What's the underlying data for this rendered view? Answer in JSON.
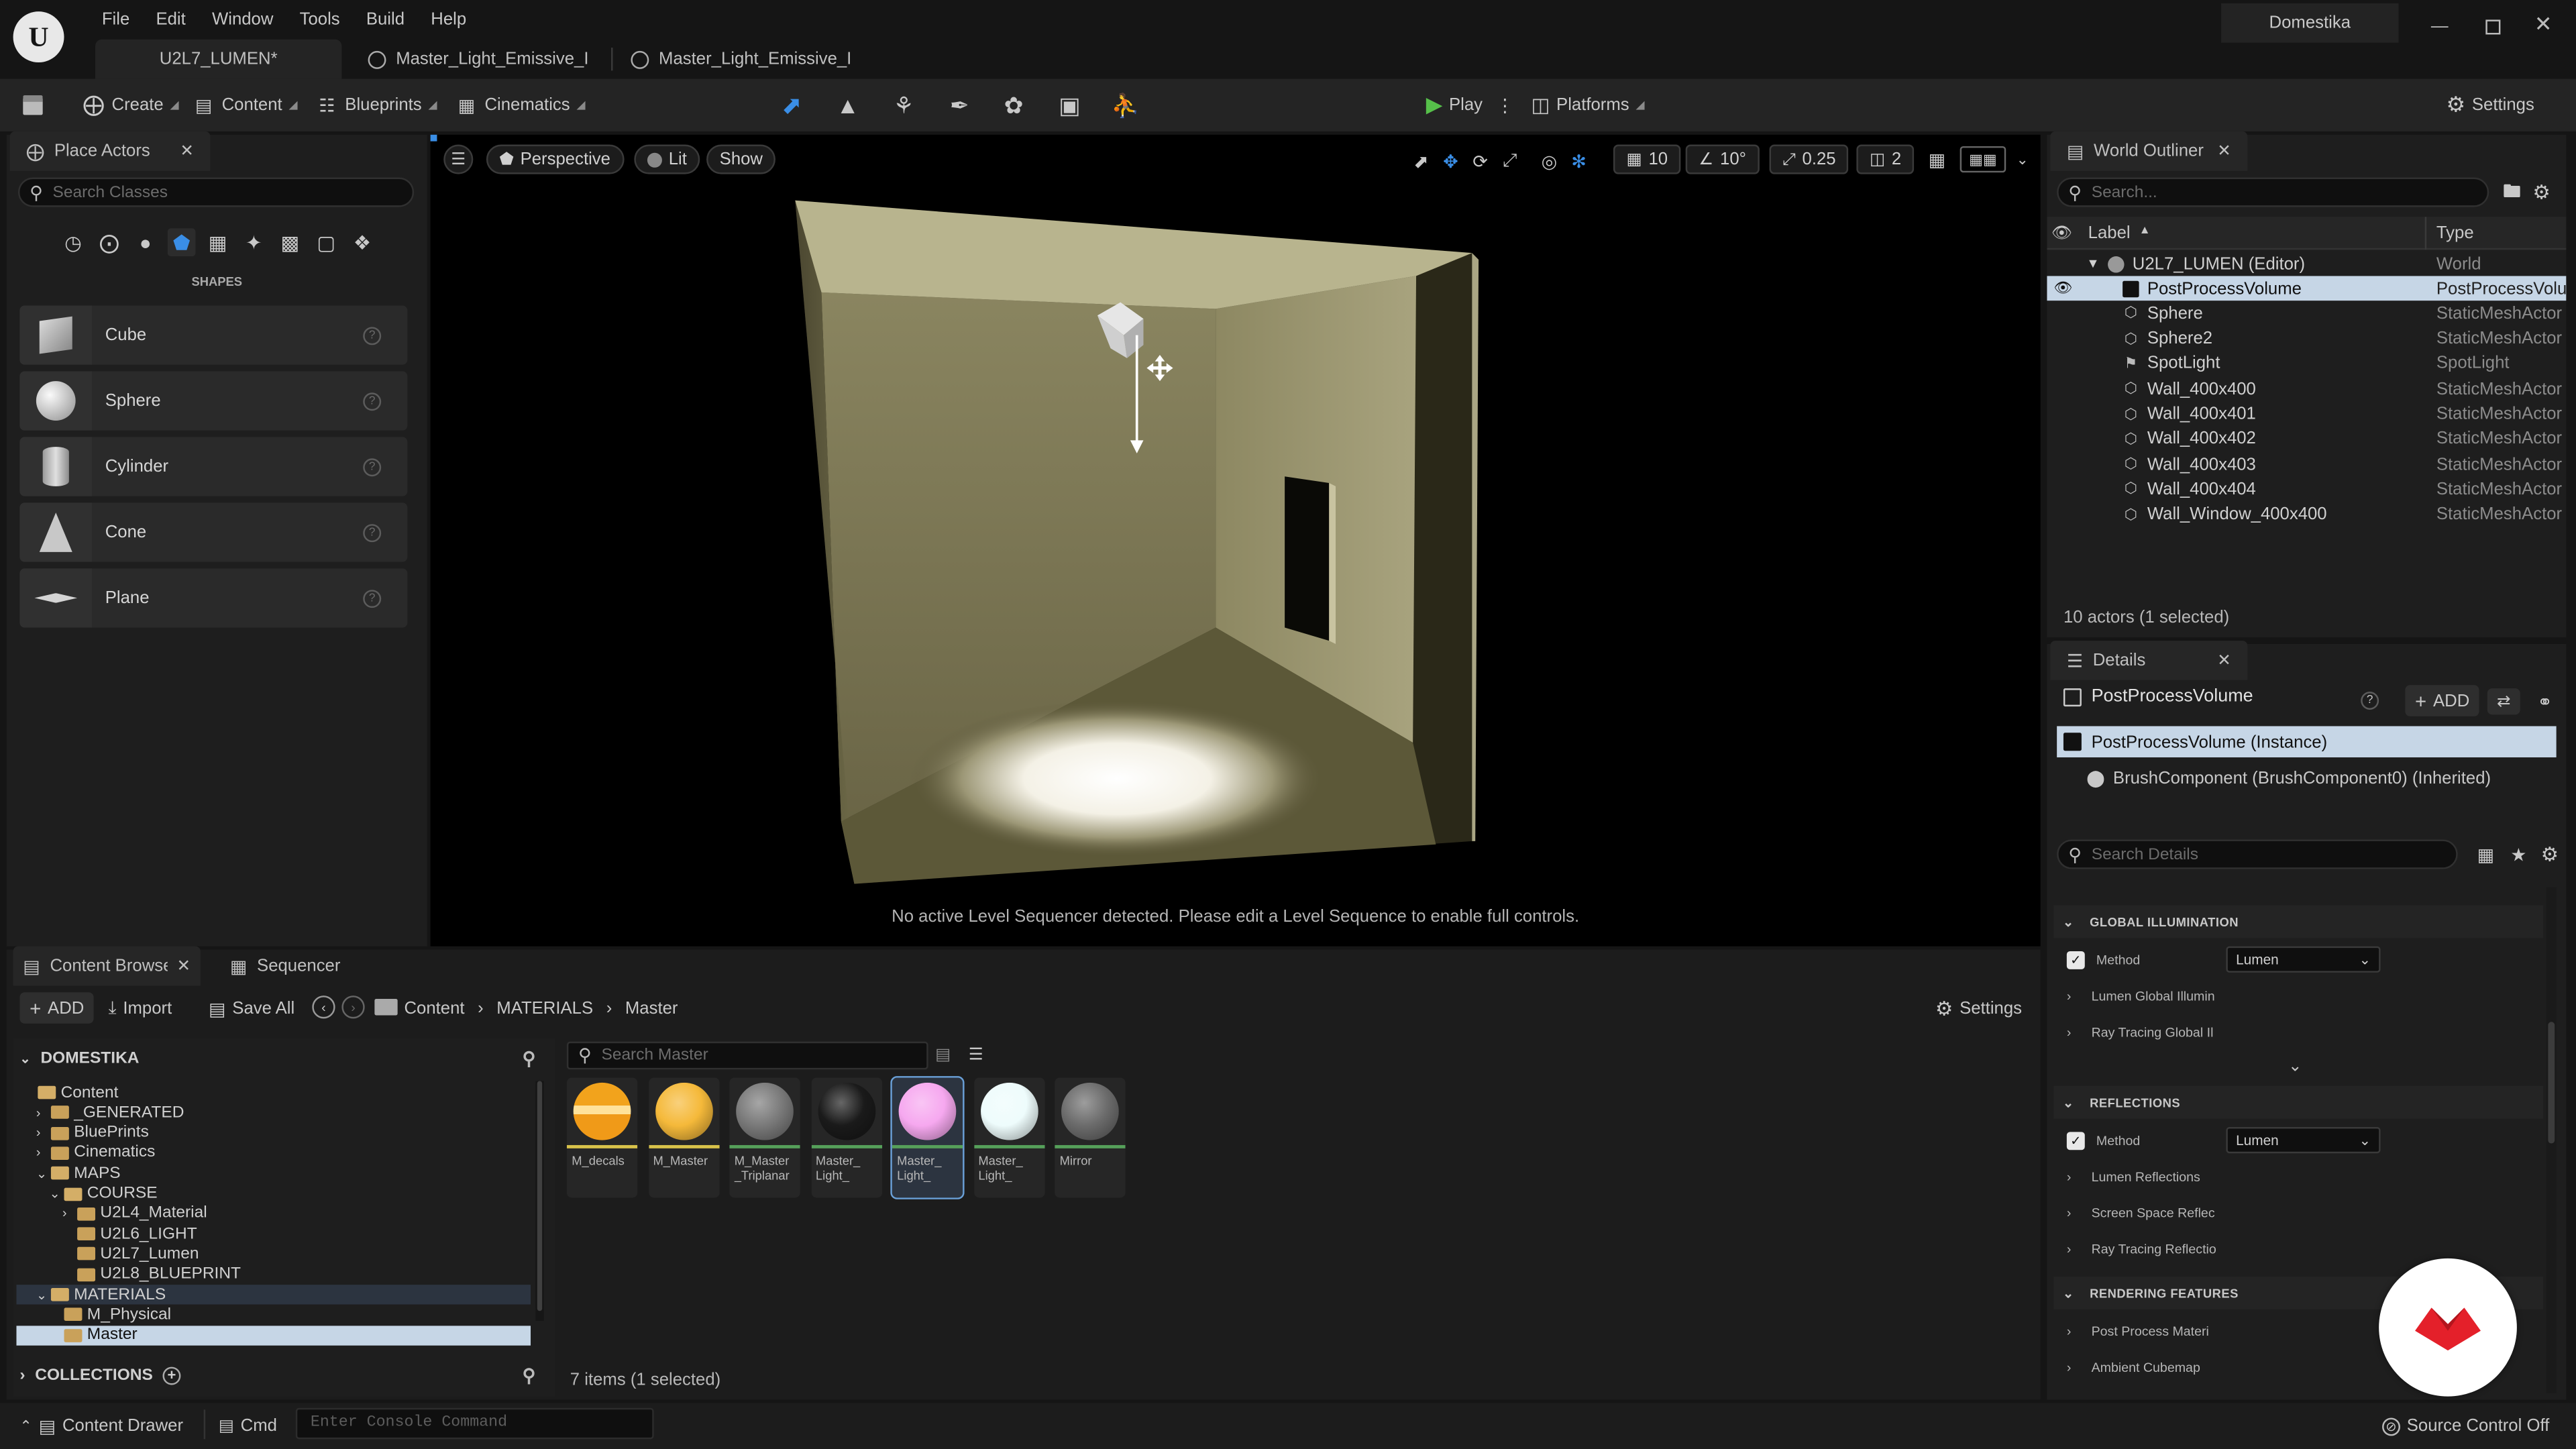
{
  "titlebar": {
    "account": "Domestika"
  },
  "menu": [
    "File",
    "Edit",
    "Window",
    "Tools",
    "Build",
    "Help"
  ],
  "doc_tabs": [
    {
      "label": "U2L7_LUMEN*"
    },
    {
      "label": "Master_Light_Emissive_I"
    },
    {
      "label": "Master_Light_Emissive_I"
    }
  ],
  "toolbar": {
    "create": "Create",
    "content": "Content",
    "blueprints": "Blueprints",
    "cinematics": "Cinematics",
    "play": "Play",
    "platforms": "Platforms",
    "settings": "Settings"
  },
  "place_actors": {
    "tab": "Place Actors",
    "search_placeholder": "Search Classes",
    "section": "SHAPES",
    "items": [
      "Cube",
      "Sphere",
      "Cylinder",
      "Cone",
      "Plane"
    ]
  },
  "viewport": {
    "perspective": "Perspective",
    "lit": "Lit",
    "show": "Show",
    "grid_snap": "10",
    "rot_snap": "10°",
    "scale_snap": "0.25",
    "camera_speed": "2",
    "message": "No active Level Sequencer detected. Please edit a Level Sequence to enable full controls."
  },
  "outliner": {
    "tab": "World Outliner",
    "search_placeholder": "Search...",
    "col_label": "Label",
    "col_type": "Type",
    "root": {
      "label": "U2L7_LUMEN (Editor)",
      "type": "World"
    },
    "rows": [
      {
        "label": "PostProcessVolume",
        "type": "PostProcessVolume",
        "selected": true
      },
      {
        "label": "Sphere",
        "type": "StaticMeshActor"
      },
      {
        "label": "Sphere2",
        "type": "StaticMeshActor"
      },
      {
        "label": "SpotLight",
        "type": "SpotLight"
      },
      {
        "label": "Wall_400x400",
        "type": "StaticMeshActor"
      },
      {
        "label": "Wall_400x401",
        "type": "StaticMeshActor"
      },
      {
        "label": "Wall_400x402",
        "type": "StaticMeshActor"
      },
      {
        "label": "Wall_400x403",
        "type": "StaticMeshActor"
      },
      {
        "label": "Wall_400x404",
        "type": "StaticMeshActor"
      },
      {
        "label": "Wall_Window_400x400",
        "type": "StaticMeshActor"
      }
    ],
    "status": "10 actors (1 selected)"
  },
  "details": {
    "tab": "Details",
    "object": "PostProcessVolume",
    "add": "ADD",
    "instance": "PostProcessVolume (Instance)",
    "component": "BrushComponent (BrushComponent0) (Inherited)",
    "search_placeholder": "Search Details",
    "global_illumination": {
      "header": "GLOBAL ILLUMINATION",
      "method_label": "Method",
      "method_value": "Lumen",
      "items": [
        "Lumen Global Illumin",
        "Ray Tracing Global Il"
      ]
    },
    "reflections": {
      "header": "REFLECTIONS",
      "method_label": "Method",
      "method_value": "Lumen",
      "items": [
        "Lumen Reflections",
        "Screen Space Reflec",
        "Ray Tracing Reflectio"
      ]
    },
    "rendering": {
      "header": "RENDERING FEATURES",
      "items": [
        "Post Process Materi",
        "Ambient Cubemap"
      ]
    }
  },
  "content_browser": {
    "tab": "Content Browser",
    "tab2": "Sequencer",
    "add": "ADD",
    "import": "Import",
    "save_all": "Save All",
    "path": [
      "Content",
      "MATERIALS",
      "Master"
    ],
    "settings": "Settings",
    "root": "DOMESTIKA",
    "search_placeholder": "Search Master",
    "collections": "COLLECTIONS",
    "status": "7 items (1 selected)",
    "tree": [
      {
        "label": "Content",
        "depth": 0
      },
      {
        "label": "_GENERATED",
        "depth": 1
      },
      {
        "label": "BluePrints",
        "depth": 1
      },
      {
        "label": "Cinematics",
        "depth": 1
      },
      {
        "label": "MAPS",
        "depth": 1
      },
      {
        "label": "COURSE",
        "depth": 2
      },
      {
        "label": "U2L4_Material",
        "depth": 3
      },
      {
        "label": "U2L6_LIGHT",
        "depth": 3
      },
      {
        "label": "U2L7_Lumen",
        "depth": 3
      },
      {
        "label": "U2L8_BLUEPRINT",
        "depth": 3
      },
      {
        "label": "MATERIALS",
        "depth": 1
      },
      {
        "label": "M_Physical",
        "depth": 2
      },
      {
        "label": "Master",
        "depth": 2
      }
    ],
    "assets": [
      {
        "name": "M_decals",
        "color": "#f0a020"
      },
      {
        "name": "M_Master",
        "color": "#f5b93a"
      },
      {
        "name": "M_Master _Triplanar",
        "color": "#7a7a7a"
      },
      {
        "name": "Master_ Light_",
        "color": "#1a1a1a"
      },
      {
        "name": "Master_ Light_",
        "color": "#f6a8ef"
      },
      {
        "name": "Master_ Light_",
        "color": "#eefcfc"
      },
      {
        "name": "Mirror",
        "color": "#6c6c6c"
      }
    ]
  },
  "statusbar": {
    "drawer": "Content Drawer",
    "cmd": "Cmd",
    "console_placeholder": "Enter Console Command",
    "source_control": "Source Control Off"
  }
}
